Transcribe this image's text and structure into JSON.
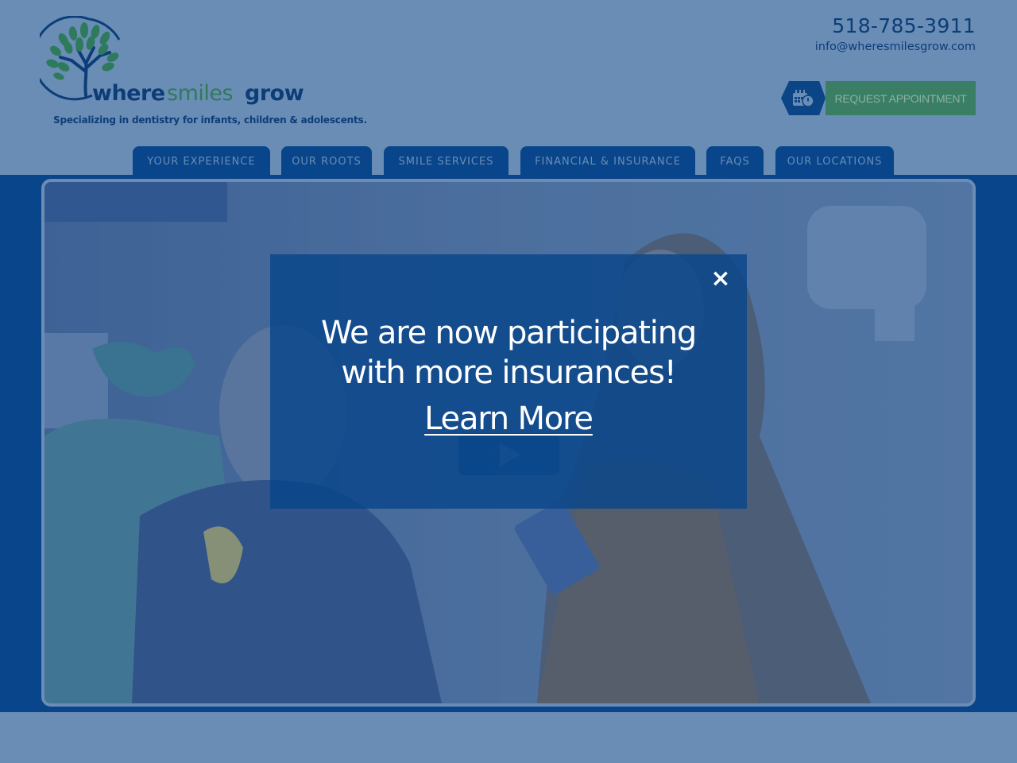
{
  "header": {
    "logo": {
      "word1": "where",
      "word2": "smiles",
      "word3": "grow",
      "icon": "tree-logo-icon"
    },
    "tagline": "Specializing in dentistry for infants, children & adolescents.",
    "phone": "518-785-3911",
    "email": "info@wheresmilesgrow.com",
    "appointment_button": {
      "label": "REQUEST APPOINTMENT",
      "icon": "calendar-clock-icon"
    }
  },
  "nav": {
    "items": [
      {
        "label": "YOUR EXPERIENCE"
      },
      {
        "label": "OUR ROOTS"
      },
      {
        "label": "SMILE SERVICES"
      },
      {
        "label": "FINANCIAL & INSURANCE"
      },
      {
        "label": "FAQS"
      },
      {
        "label": "OUR LOCATIONS"
      }
    ]
  },
  "hero": {
    "image_description": "Child in dental chair smiling with woman holding tablet",
    "play_icon": "play-icon"
  },
  "modal": {
    "heading_line1": "We are now participating",
    "heading_line2": "with more insurances!",
    "link_label": "Learn More",
    "close_icon": "×"
  },
  "colors": {
    "page_bg": "#6a8db5",
    "brand_blue": "#08458a",
    "brand_green": "#3a7f65",
    "text_dark": "#0c3d78",
    "modal_text": "#ffffff"
  }
}
